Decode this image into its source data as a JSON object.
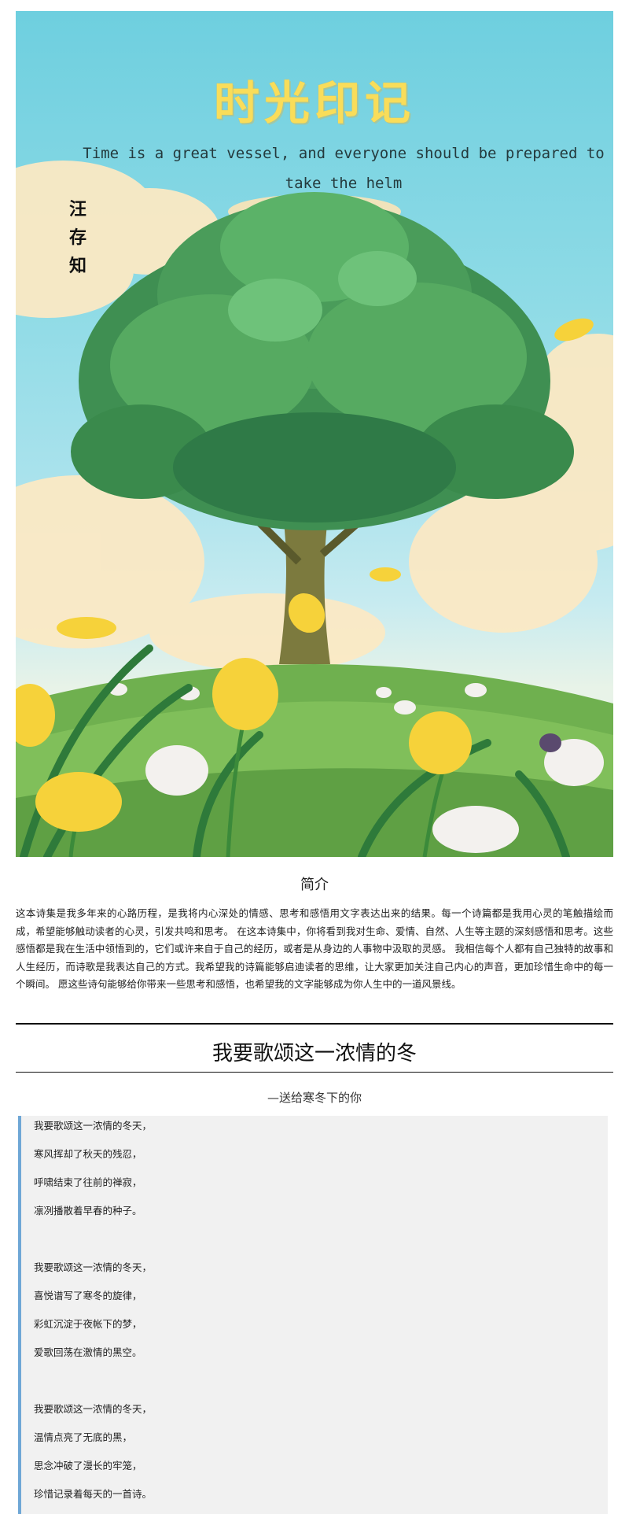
{
  "cover": {
    "title": "时光印记",
    "quote": "Time is a great vessel, and everyone should be prepared to take the helm",
    "author_chars": [
      "汪",
      "存",
      "知"
    ]
  },
  "intro": {
    "heading": "简介",
    "text": "这本诗集是我多年来的心路历程，是我将内心深处的情感、思考和感悟用文字表达出来的结果。每一个诗篇都是我用心灵的笔触描绘而成，希望能够触动读者的心灵，引发共鸣和思考。 在这本诗集中，你将看到我对生命、爱情、自然、人生等主题的深刻感悟和思考。这些感悟都是我在生活中领悟到的，它们或许来自于自己的经历，或者是从身边的人事物中汲取的灵感。 我相信每个人都有自己独特的故事和人生经历，而诗歌是我表达自己的方式。我希望我的诗篇能够启迪读者的思维，让大家更加关注自己内心的声音，更加珍惜生命中的每一个瞬间。 愿这些诗句能够给你带来一些思考和感悟，也希望我的文字能够成为你人生中的一道风景线。"
  },
  "poem": {
    "title": "我要歌颂这一浓情的冬",
    "subtitle": "—送给寒冬下的你",
    "lines": [
      "我要歌颂这一浓情的冬天，",
      "寒风挥却了秋天的残忍，",
      "呼啸结束了往前的禅寂，",
      "凛冽播散着早春的种子。",
      "",
      "我要歌颂这一浓情的冬天，",
      "喜悦谱写了寒冬的旋律，",
      "彩虹沉淀于夜帐下的梦，",
      "爱歌回荡在激情的黑空。",
      "",
      "我要歌颂这一浓情的冬天，",
      "温情点亮了无底的黑，",
      "思念冲破了漫长的牢笼，",
      "珍惜记录着每天的一首诗。"
    ]
  },
  "colors": {
    "title_yellow": "#f9dd5a",
    "poem_accent": "#6fa7d6",
    "poem_bg": "#f1f1f1"
  }
}
